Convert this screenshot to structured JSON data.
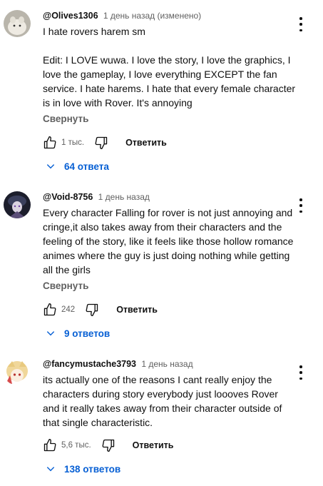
{
  "comments": [
    {
      "author": "@Olives1306",
      "time": "1 день назад (изменено)",
      "body": "I hate rovers harem sm\n\nEdit: I LOVE wuwa. I love the story, I love the graphics, I love the gameplay, I love everything EXCEPT the fan service. I hate harems. I hate that every female character is in love with Rover. It's annoying",
      "collapse": "Свернуть",
      "likes": "1 тыс.",
      "reply_label": "Ответить",
      "replies": "64 ответа",
      "avatar_color": "#cfc9bd"
    },
    {
      "author": "@Void-8756",
      "time": "1 день назад",
      "body": "Every character Falling for rover is not just annoying and cringe,it also takes away from their characters and the feeling of the story, like it feels like those hollow romance animes where the guy is just doing nothing while getting all the girls",
      "collapse": "Свернуть",
      "likes": "242",
      "reply_label": "Ответить",
      "replies": "9 ответов",
      "avatar_color": "#1c1e2c"
    },
    {
      "author": "@fancymustache3793",
      "time": "1 день назад",
      "body": "its actually one of the reasons I cant really enjoy the characters during story everybody just loooves Rover and it really takes away from their character outside of that single characteristic.",
      "collapse": "",
      "likes": "5,6 тыс.",
      "reply_label": "Ответить",
      "replies": "138 ответов",
      "avatar_color": "#f3e1b5"
    }
  ],
  "colors": {
    "link": "#065fd4",
    "secondary_text": "#606060",
    "primary_text": "#0f0f0f"
  },
  "icons": [
    "thumbs-up-icon",
    "thumbs-down-icon",
    "chevron-down-icon",
    "more-vert-icon"
  ]
}
